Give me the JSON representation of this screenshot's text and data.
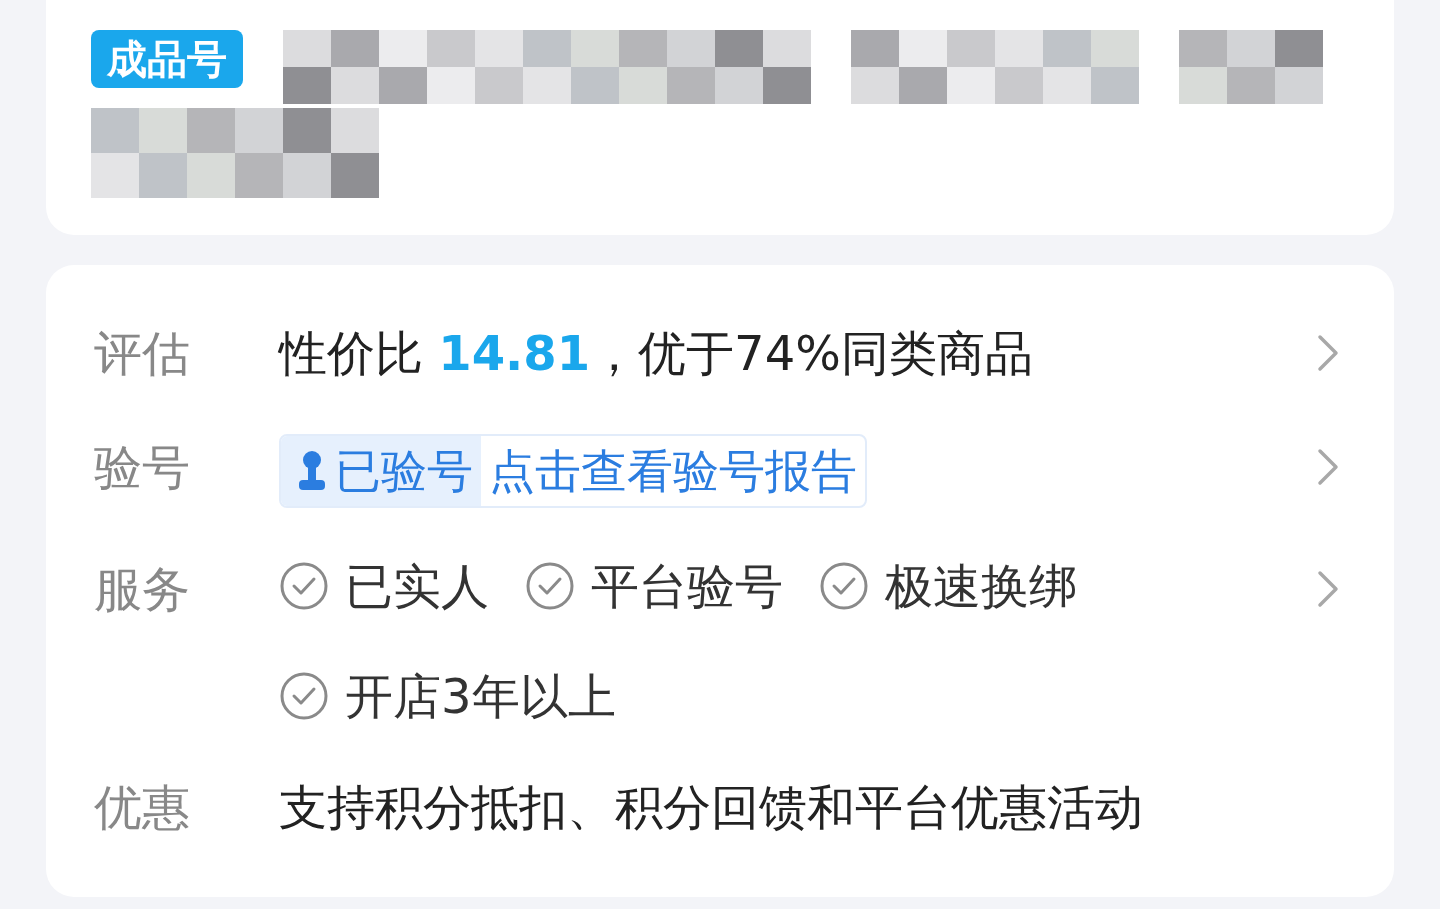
{
  "badge": "成品号",
  "rows": [
    {
      "kind": "rating",
      "label": "评估",
      "prefix": "性价比",
      "score": "14.81",
      "suffix": "，优于74%同类商品",
      "arrow": true
    },
    {
      "kind": "verify",
      "label": "验号",
      "status": "已验号",
      "link": "点击查看验号报告",
      "arrow": true
    },
    {
      "kind": "services",
      "label": "服务",
      "items": [
        "已实人",
        "平台验号",
        "极速换绑",
        "开店3年以上"
      ],
      "arrow": true
    },
    {
      "kind": "text",
      "label": "优惠",
      "text": "支持积分抵扣、积分回馈和平台优惠活动",
      "arrow": false
    }
  ]
}
